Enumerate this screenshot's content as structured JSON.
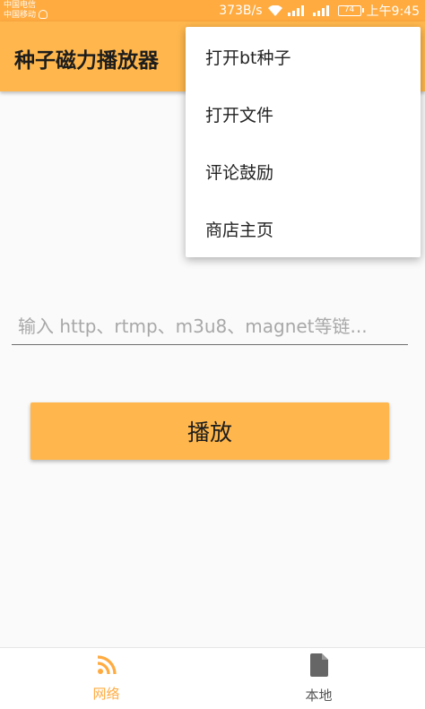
{
  "status_bar": {
    "carrier_1": "中国电信",
    "carrier_2": "中国移动",
    "net_speed": "373B/s",
    "battery": "74",
    "time": "上午9:45"
  },
  "toolbar": {
    "title": "种子磁力播放器"
  },
  "overflow_menu": {
    "items": [
      {
        "label": "打开bt种子"
      },
      {
        "label": "打开文件"
      },
      {
        "label": "评论鼓励"
      },
      {
        "label": "商店主页"
      }
    ]
  },
  "main": {
    "url_placeholder": "输入 http、rtmp、m3u8、magnet等链...",
    "url_value": "",
    "play_label": "播放"
  },
  "bottom_nav": {
    "items": [
      {
        "label": "网络",
        "icon": "rss-feed-icon",
        "active": true
      },
      {
        "label": "本地",
        "icon": "file-icon",
        "active": false
      }
    ]
  },
  "colors": {
    "accent": "#ffb74d",
    "status_bar": "#ffab40",
    "active_tab": "#ffab40"
  }
}
